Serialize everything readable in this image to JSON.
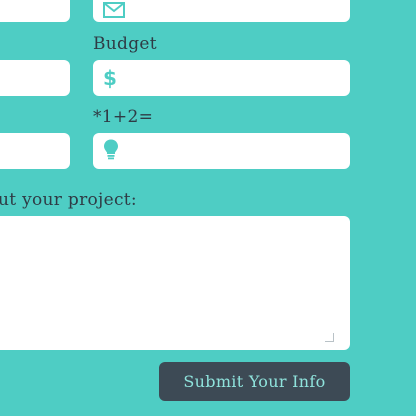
{
  "form": {
    "email_icon": "envelope-icon",
    "budget_label": "Budget",
    "budget_icon": "$",
    "captcha_label": "*1+2=",
    "captcha_icon": "lightbulb-icon",
    "project_label": "ut your project:",
    "submit_label": "Submit Your Info"
  },
  "colors": {
    "background": "#4ecdc4",
    "field": "#ffffff",
    "text": "#2f3b45",
    "button_bg": "#3d4a55",
    "button_text": "#8fe3dc"
  }
}
